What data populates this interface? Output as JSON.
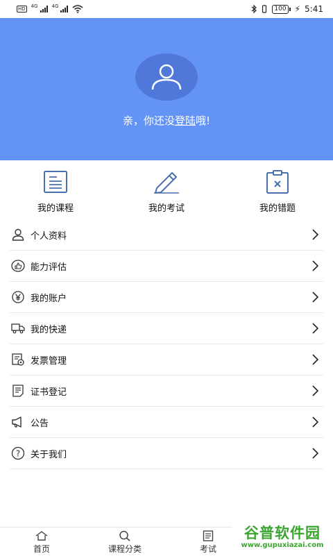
{
  "status_bar": {
    "left_tags": [
      "HD",
      "4G",
      "4G"
    ],
    "battery": "100",
    "time": "5:41"
  },
  "header": {
    "prompt_prefix": "亲，你还没",
    "login_link": "登陆",
    "prompt_suffix": "哦!",
    "bg_color": "#6394f5"
  },
  "quick_actions": [
    {
      "label": "我的课程",
      "icon": "document-icon"
    },
    {
      "label": "我的考试",
      "icon": "pencil-icon"
    },
    {
      "label": "我的错题",
      "icon": "clipboard-x-icon"
    }
  ],
  "menu": [
    {
      "label": "个人资料",
      "icon": "person-icon"
    },
    {
      "label": "能力评估",
      "icon": "thumbs-up-icon"
    },
    {
      "label": "我的账户",
      "icon": "yen-icon"
    },
    {
      "label": "我的快递",
      "icon": "truck-icon"
    },
    {
      "label": "发票管理",
      "icon": "invoice-icon"
    },
    {
      "label": "证书登记",
      "icon": "certificate-icon"
    },
    {
      "label": "公告",
      "icon": "megaphone-icon"
    },
    {
      "label": "关于我们",
      "icon": "question-icon"
    }
  ],
  "tabs": [
    {
      "label": "首页",
      "icon": "home-icon"
    },
    {
      "label": "课程分类",
      "icon": "search-icon"
    },
    {
      "label": "考试",
      "icon": "exam-icon"
    }
  ],
  "watermark": {
    "name": "谷普软件园",
    "url": "www.gupuxiazai.com"
  }
}
